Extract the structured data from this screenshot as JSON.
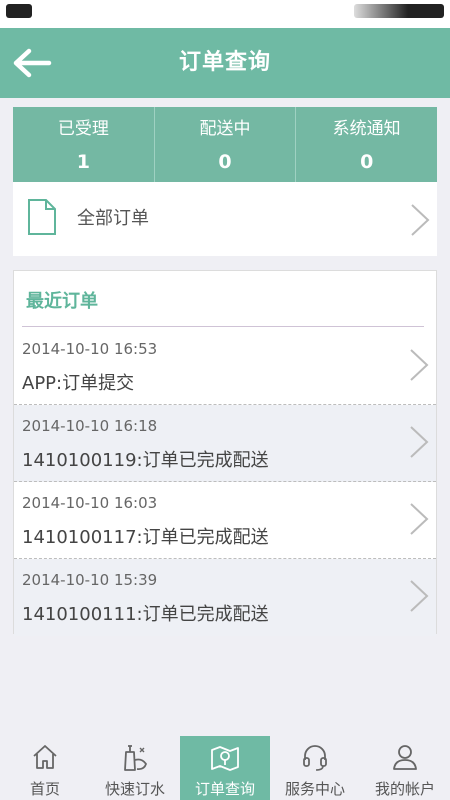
{
  "header": {
    "title": "订单查询",
    "back_icon": "arrow-left-icon"
  },
  "stats": [
    {
      "label": "已受理",
      "value": "1"
    },
    {
      "label": "配送中",
      "value": "0"
    },
    {
      "label": "系统通知",
      "value": "0"
    }
  ],
  "all_orders": {
    "label": "全部订单",
    "icon": "document-icon"
  },
  "recent": {
    "title": "最近订单",
    "orders": [
      {
        "time": "2014-10-10 16:53",
        "desc": "APP:订单提交"
      },
      {
        "time": "2014-10-10 16:18",
        "desc": "1410100119:订单已完成配送"
      },
      {
        "time": "2014-10-10 16:03",
        "desc": "1410100117:订单已完成配送"
      },
      {
        "time": "2014-10-10 15:39",
        "desc": "1410100111:订单已完成配送"
      }
    ]
  },
  "tabs": [
    {
      "label": "首页",
      "icon": "home-icon"
    },
    {
      "label": "快速订水",
      "icon": "water-order-icon"
    },
    {
      "label": "订单查询",
      "icon": "map-icon",
      "active": true
    },
    {
      "label": "服务中心",
      "icon": "headset-icon"
    },
    {
      "label": "我的帐户",
      "icon": "user-icon"
    }
  ],
  "colors": {
    "accent": "#6fbaa4",
    "title_green": "#5fb59b"
  }
}
